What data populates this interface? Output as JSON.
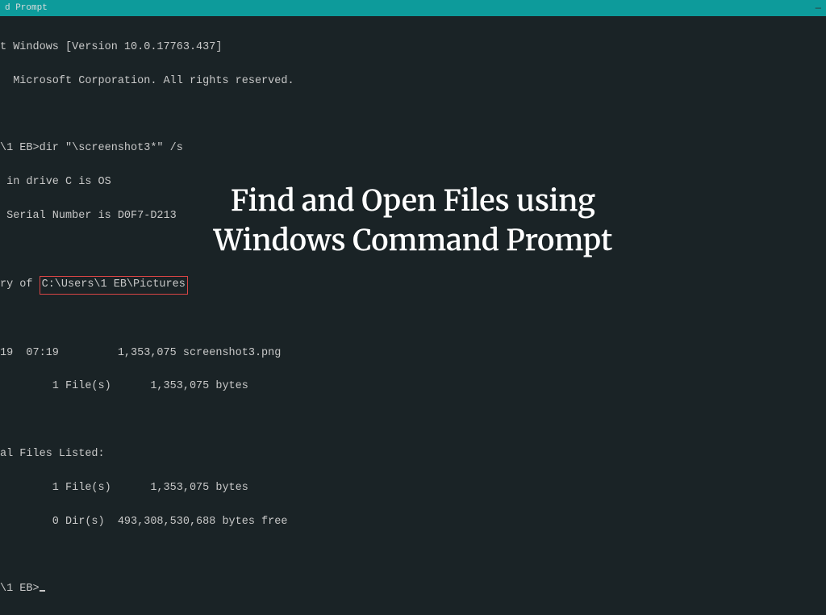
{
  "window": {
    "title": "d Prompt"
  },
  "terminal": {
    "lines": {
      "l1": "t Windows [Version 10.0.17763.437]",
      "l2": "  Microsoft Corporation. All rights reserved.",
      "l3_prompt": "\\1 EB>",
      "l3_cmd": "dir \"\\screenshot3*\" /s",
      "l4": " in drive C is OS",
      "l5": " Serial Number is D0F7-D213",
      "l6_prefix": "ry of ",
      "l6_path": "C:\\Users\\1 EB\\Pictures",
      "l7": "19  07:19         1,353,075 screenshot3.png",
      "l8": "        1 File(s)      1,353,075 bytes",
      "l9": "al Files Listed:",
      "l10": "        1 File(s)      1,353,075 bytes",
      "l11": "        0 Dir(s)  493,308,530,688 bytes free",
      "l12_prompt": "\\1 EB>"
    }
  },
  "overlay": {
    "line1": "Find and Open Files using",
    "line2": "Windows Command Prompt"
  }
}
